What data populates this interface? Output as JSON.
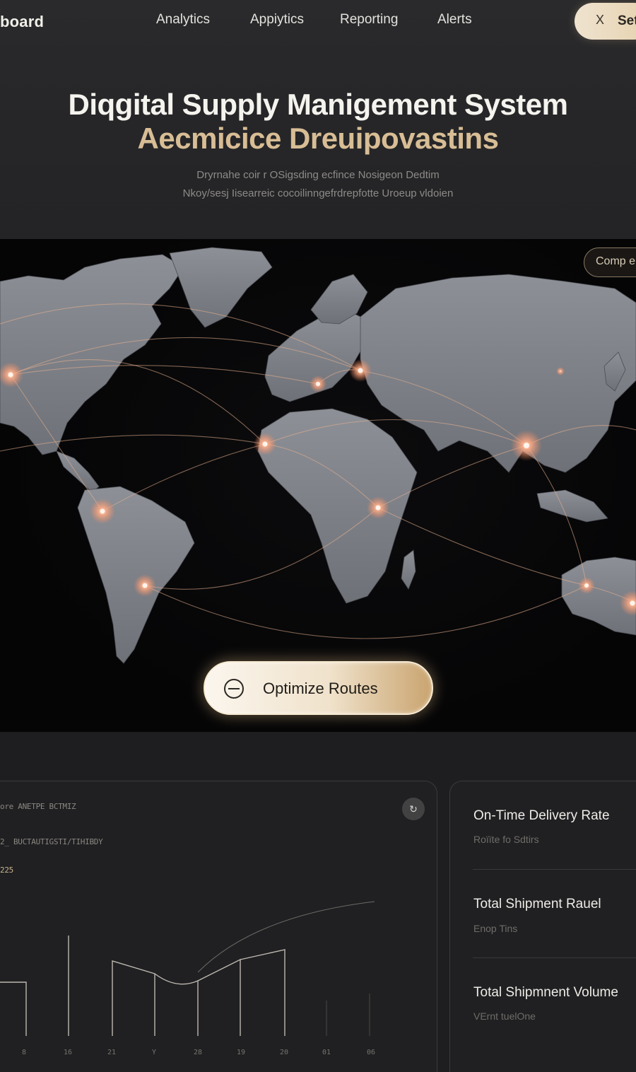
{
  "header": {
    "brand": "board",
    "nav": [
      "Analytics",
      "Appiytics",
      "Reporting",
      "Alerts"
    ],
    "set_button": {
      "icon": "close-icon",
      "glyph": "X",
      "label": "Set"
    }
  },
  "hero": {
    "title": "Diqgital Supply Manigement System",
    "subtitle": "Aecmicice Dreuipovastins",
    "description_line1": "Dryrnahe coir r OSigsding ecfince Nosigeon Dedtim",
    "description_line2": "Nkoy/sesj Iisearreic cocoilinngefrdrepfotte Uroeup vldoien"
  },
  "map": {
    "compare_button": "Comp e",
    "optimize_button": "Optimize Routes",
    "optimize_icon": "route-icon",
    "accent_color": "#f3a07e"
  },
  "chart_panel": {
    "label1": "ore ANETPE BCTMIZ",
    "label2": "2_ BUCTAUTIGSTI/TIHIBDY",
    "label3": "225",
    "refresh_icon": "refresh-icon",
    "chart_data": {
      "type": "bar",
      "categories": [
        "8",
        "16",
        "21",
        "Y",
        "28",
        "19",
        "20",
        "01",
        "06"
      ],
      "values": [
        null,
        null,
        null,
        null,
        null,
        null,
        null,
        null,
        null
      ]
    },
    "x_ticks": [
      "8",
      "16",
      "21",
      "Y",
      "28",
      "19",
      "20",
      "01",
      "06"
    ]
  },
  "kpi_panel": {
    "items": [
      {
        "title": "On-Time Delivery Rate",
        "sub": "Roïïte fo Sdtirs"
      },
      {
        "title": "Total Shipment Rauel",
        "sub": "Enop Tins"
      },
      {
        "title": "Total Shipmnent Volume",
        "sub": "VErnt tuelOne"
      }
    ]
  }
}
